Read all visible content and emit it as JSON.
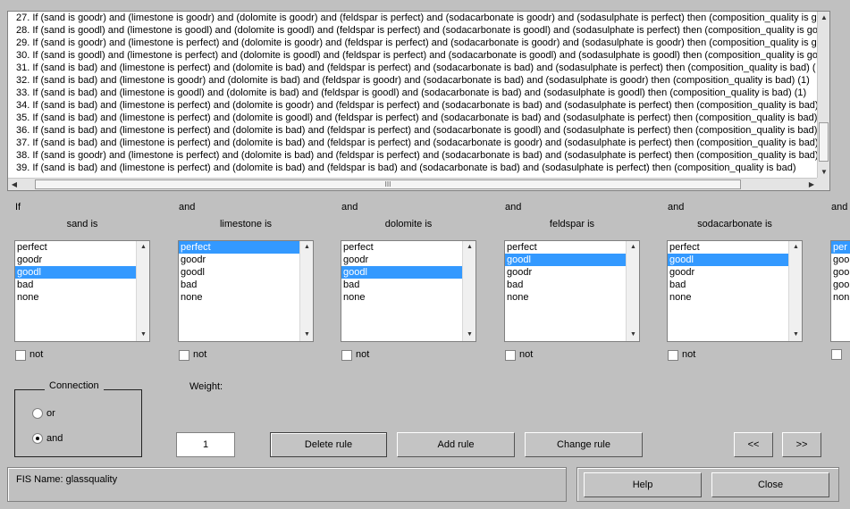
{
  "rules": [
    "27. If (sand is goodr) and (limestone is goodr) and (dolomite is goodr) and (feldspar is perfect) and (sodacarbonate is goodr) and (sodasulphate is perfect) then (composition_quality is g",
    "28. If (sand is goodl) and (limestone is goodl) and (dolomite is goodl) and (feldspar is perfect) and (sodacarbonate is goodl) and (sodasulphate is perfect) then (composition_quality is goo",
    "29. If (sand is goodr) and (limestone is perfect) and (dolomite is goodr) and (feldspar is perfect) and (sodacarbonate is goodr) and (sodasulphate is goodr) then (composition_quality is g",
    "30. If (sand is goodl) and (limestone is perfect) and (dolomite is goodl) and (feldspar is perfect) and (sodacarbonate is goodl) and (sodasulphate is goodl) then (composition_quality is goo",
    "31. If (sand is bad) and (limestone is perfect) and (dolomite is bad) and (feldspar is perfect) and (sodacarbonate is bad) and (sodasulphate is perfect) then (composition_quality is bad) (",
    "32. If (sand is bad) and (limestone is goodr) and (dolomite is bad) and (feldspar is goodr) and (sodacarbonate is bad) and (sodasulphate is goodr) then (composition_quality is bad) (1)",
    "33. If (sand is bad) and (limestone is goodl) and (dolomite is bad) and (feldspar is goodl) and (sodacarbonate is bad) and (sodasulphate is goodl) then (composition_quality is bad) (1)",
    "34. If (sand is bad) and (limestone is perfect) and (dolomite is goodr) and (feldspar is perfect) and (sodacarbonate is bad) and (sodasulphate is perfect) then (composition_quality is bad)",
    "35. If (sand is bad) and (limestone is perfect) and (dolomite is goodl) and (feldspar is perfect) and (sodacarbonate is bad) and (sodasulphate is perfect) then (composition_quality is bad)",
    "36. If (sand is bad) and (limestone is perfect) and (dolomite is bad) and (feldspar is perfect) and (sodacarbonate is goodl) and (sodasulphate is perfect) then (composition_quality is bad)",
    "37. If (sand is bad) and (limestone is perfect) and (dolomite is bad) and (feldspar is perfect) and (sodacarbonate is goodr) and (sodasulphate is perfect) then (composition_quality is bad)",
    "38. If (sand is goodr) and (limestone is perfect) and (dolomite is bad) and (feldspar is perfect) and (sodacarbonate is bad) and (sodasulphate is perfect) then (composition_quality is bad)",
    "39. If (sand is bad) and (limestone is perfect) and (dolomite is bad) and (feldspar is bad) and (sodacarbonate is bad) and (sodasulphate is perfect) then (composition_quality is bad)"
  ],
  "rules_hscroll_grip": "III",
  "inputs": [
    {
      "prefix": "If",
      "title": "sand is",
      "options": [
        "perfect",
        "goodr",
        "goodl",
        "bad",
        "none"
      ],
      "selected": "goodl",
      "not_label": "not"
    },
    {
      "prefix": "and",
      "title": "limestone is",
      "options": [
        "perfect",
        "goodr",
        "goodl",
        "bad",
        "none"
      ],
      "selected": "perfect",
      "not_label": "not"
    },
    {
      "prefix": "and",
      "title": "dolomite is",
      "options": [
        "perfect",
        "goodr",
        "goodl",
        "bad",
        "none"
      ],
      "selected": "goodl",
      "not_label": "not"
    },
    {
      "prefix": "and",
      "title": "feldspar is",
      "options": [
        "perfect",
        "goodl",
        "goodr",
        "bad",
        "none"
      ],
      "selected": "goodl",
      "not_label": "not"
    },
    {
      "prefix": "and",
      "title": "sodacarbonate is",
      "options": [
        "perfect",
        "goodl",
        "goodr",
        "bad",
        "none"
      ],
      "selected": "goodl",
      "not_label": "not"
    }
  ],
  "partial_input": {
    "prefix": "and",
    "options": [
      "per",
      "goo",
      "goo",
      "goo",
      "non"
    ],
    "selected": "per"
  },
  "connection": {
    "title": "Connection",
    "options": [
      "or",
      "and"
    ],
    "selected": "and"
  },
  "weight": {
    "label": "Weight:",
    "value": "1"
  },
  "buttons": {
    "delete_rule": "Delete rule",
    "add_rule": "Add rule",
    "change_rule": "Change rule",
    "prev": "<<",
    "next": ">>",
    "help": "Help",
    "close": "Close"
  },
  "status": {
    "fis_name": "FIS Name: glassquality"
  }
}
